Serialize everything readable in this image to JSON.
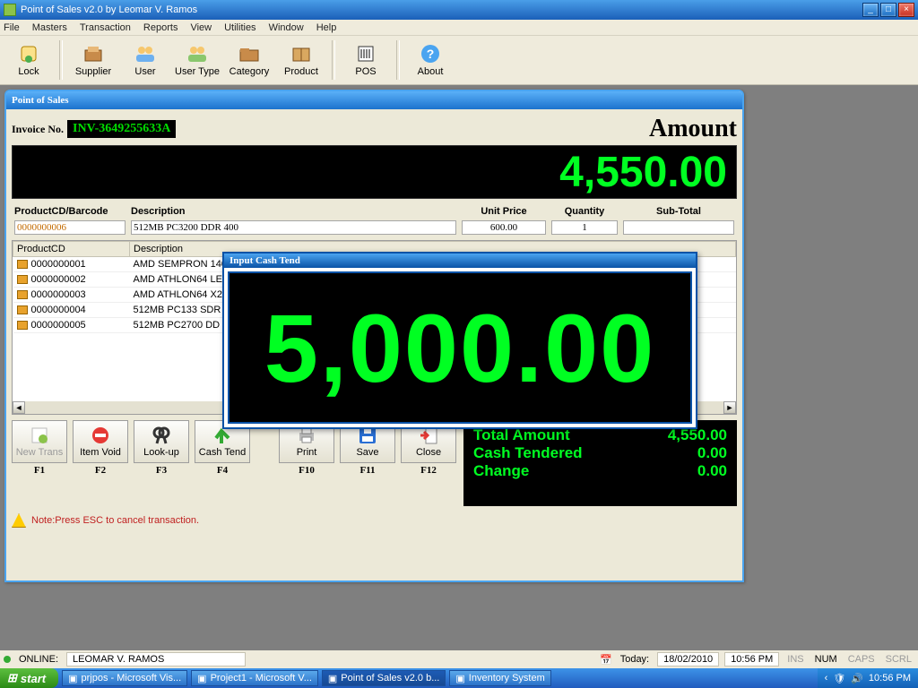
{
  "window": {
    "title": "Point of Sales v2.0 by Leomar V. Ramos"
  },
  "menu": {
    "items": [
      "File",
      "Masters",
      "Transaction",
      "Reports",
      "View",
      "Utilities",
      "Window",
      "Help"
    ]
  },
  "toolbar": {
    "groups": [
      [
        "Lock"
      ],
      [
        "Supplier",
        "User",
        "User Type",
        "Category",
        "Product"
      ],
      [
        "POS"
      ],
      [
        "About"
      ]
    ]
  },
  "pos": {
    "title": "Point of Sales",
    "invoice_label": "Invoice No.",
    "invoice": "INV-3649255633A",
    "amount_label": "Amount",
    "amount": "4,550.00",
    "entry_headers": [
      "ProductCD/Barcode",
      "Description",
      "Unit Price",
      "Quantity",
      "Sub-Total"
    ],
    "entry": {
      "code": "0000000006",
      "desc": "512MB PC3200 DDR 400",
      "price": "600.00",
      "qty": "1",
      "sub": ""
    },
    "grid_headers": [
      "ProductCD",
      "Description"
    ],
    "grid_rows": [
      {
        "code": "0000000001",
        "desc": "AMD SEMPRON 140"
      },
      {
        "code": "0000000002",
        "desc": "AMD ATHLON64 LE"
      },
      {
        "code": "0000000003",
        "desc": "AMD ATHLON64 X2"
      },
      {
        "code": "0000000004",
        "desc": "512MB PC133 SDR"
      },
      {
        "code": "0000000005",
        "desc": "512MB PC2700 DD"
      }
    ],
    "actions": [
      {
        "label": "New Trans",
        "fk": "F1",
        "gray": true
      },
      {
        "label": "Item Void",
        "fk": "F2"
      },
      {
        "label": "Look-up",
        "fk": "F3"
      },
      {
        "label": "Cash Tend",
        "fk": "F4"
      },
      {
        "label": "Print",
        "fk": "F10"
      },
      {
        "label": "Save",
        "fk": "F11"
      },
      {
        "label": "Close",
        "fk": "F12"
      }
    ],
    "totals": {
      "total_label": "Total Amount",
      "total": "4,550.00",
      "tend_label": "Cash Tendered",
      "tend": "0.00",
      "change_label": "Change",
      "change": "0.00"
    },
    "note": "Note:Press ESC to cancel transaction."
  },
  "modal": {
    "title": "Input Cash Tend",
    "value": "5,000.00"
  },
  "status": {
    "online": "ONLINE:",
    "user": "LEOMAR V. RAMOS",
    "today_label": "Today:",
    "date": "18/02/2010",
    "time": "10:56 PM",
    "ins": "INS",
    "num": "NUM",
    "caps": "CAPS",
    "scrl": "SCRL"
  },
  "taskbar": {
    "start": "start",
    "tasks": [
      "prjpos - Microsoft Vis...",
      "Project1 - Microsoft V...",
      "Point of Sales v2.0 b...",
      "Inventory System"
    ],
    "active_index": 2,
    "clock": "10:56 PM"
  }
}
